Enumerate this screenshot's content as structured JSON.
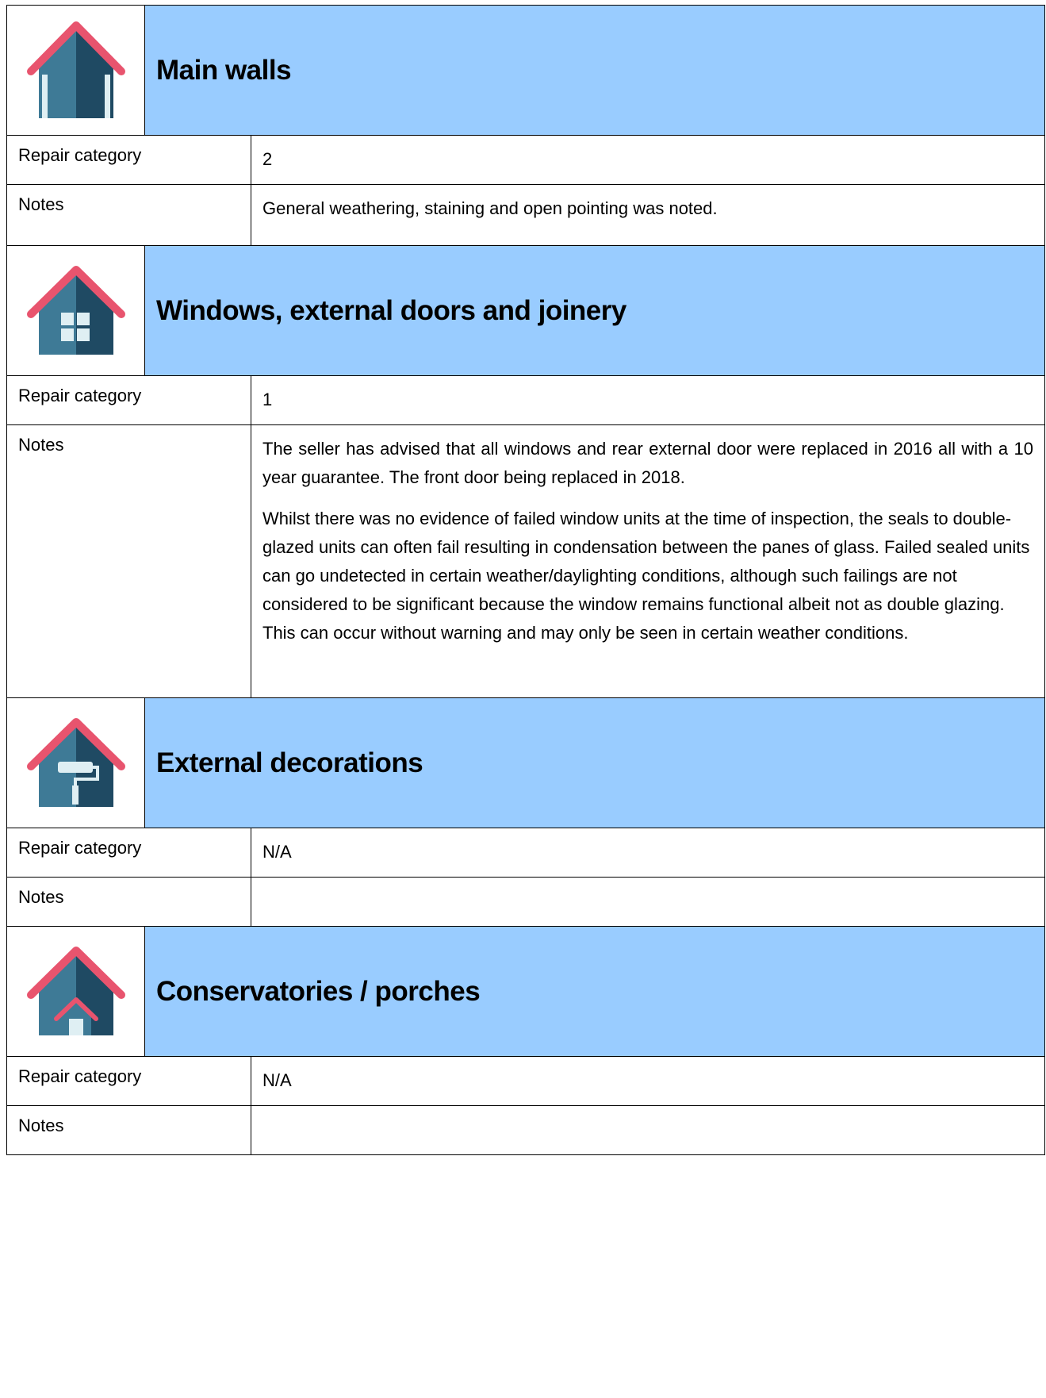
{
  "sections": [
    {
      "icon": "house-walls-icon",
      "title": "Main walls",
      "repair_label": "Repair category",
      "repair_value": "2",
      "notes_label": "Notes",
      "notes": [
        "General weathering, staining and open pointing was noted."
      ]
    },
    {
      "icon": "house-window-icon",
      "title": "Windows, external doors and joinery",
      "repair_label": "Repair category",
      "repair_value": "1",
      "notes_label": "Notes",
      "notes": [
        "The seller has advised that all windows and rear external door were replaced in 2016 all with a 10 year guarantee.  The front door being replaced in 2018.",
        "Whilst there was no evidence of failed window units at the time of inspection, the seals to double-glazed units can often fail resulting in condensation between the panes of glass. Failed sealed units can go undetected in certain weather/daylighting conditions, although such failings are not considered to be significant because the window remains functional albeit not as double glazing. This can occur without warning and may only be seen in certain weather conditions."
      ]
    },
    {
      "icon": "house-paint-roller-icon",
      "title": "External decorations",
      "repair_label": "Repair category",
      "repair_value": "N/A",
      "notes_label": "Notes",
      "notes": []
    },
    {
      "icon": "house-porch-icon",
      "title": "Conservatories / porches",
      "repair_label": "Repair category",
      "repair_value": "N/A",
      "notes_label": "Notes",
      "notes": []
    }
  ],
  "colors": {
    "header_bg": "#99ccff",
    "roof": "#e8546e",
    "house_light": "#3e7a96",
    "house_dark": "#1f4a63",
    "window": "#dfeff3"
  }
}
